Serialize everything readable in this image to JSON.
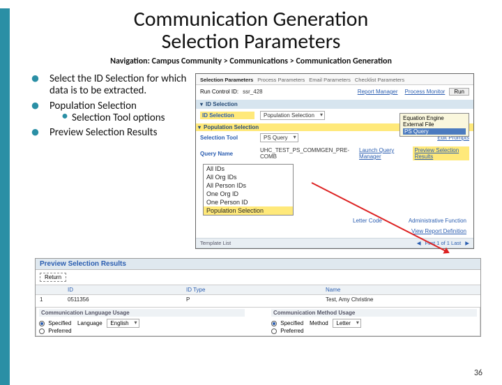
{
  "title_line1": "Communication Generation",
  "title_line2": "Selection Parameters",
  "navigation": "Navigation: Campus Community > Communications > Communication Generation",
  "bullets": {
    "b1": "Select the ID Selection for which data is to be extracted.",
    "b2": "Population Selection",
    "b2_sub": "Selection Tool options",
    "b3": "Preview Selection Results"
  },
  "screenshot": {
    "tabs": [
      "Selection Parameters",
      "Process Parameters",
      "Email Parameters",
      "Checklist Parameters"
    ],
    "run_control_label": "Run Control ID:",
    "run_control_value": "ssr_428",
    "report_manager": "Report Manager",
    "process_monitor": "Process Monitor",
    "run": "Run",
    "idsel_header": "ID Selection",
    "idsel_label": "ID Selection",
    "idsel_value": "Population Selection",
    "tip1": "Equation Engine",
    "tip2": "External File",
    "tip3": "PS Query",
    "popsel_header": "Population Selection",
    "sel_tool_label": "Selection Tool",
    "sel_tool_value": "PS Query",
    "query_name_label": "Query Name",
    "query_name_value": "UHC_TEST_PS_COMMGEN_PRE-COMB",
    "edit_prompts": "Edit Prompts",
    "launch_qm": "Launch Query Manager",
    "preview_link": "Preview Selection Results",
    "dropdown": [
      "All IDs",
      "All Org IDs",
      "All Person IDs",
      "One Org ID",
      "One Person ID",
      "Population Selection"
    ],
    "letter_code_label": "Letter Code",
    "admin_fn_label": "Administrative Function",
    "view_report_def": "View Report Definition",
    "template_list": "Template List",
    "first_last": "First  1 of 1  Last"
  },
  "wide": {
    "title": "Preview Selection Results",
    "return": "Return",
    "h_blank": "",
    "h_id": "ID",
    "h_idtype": "ID Type",
    "h_name": "Name",
    "row_num": "1",
    "row_id": "0511356",
    "row_type": "P",
    "row_name": "Test, Amy Christine",
    "lang_title": "Communication Language Usage",
    "method_title": "Communication Method Usage",
    "specified": "Specified",
    "preferred": "Preferred",
    "language_label": "Language",
    "language_value": "English",
    "method_label": "Method",
    "method_value": "Letter"
  },
  "page_number": "36"
}
